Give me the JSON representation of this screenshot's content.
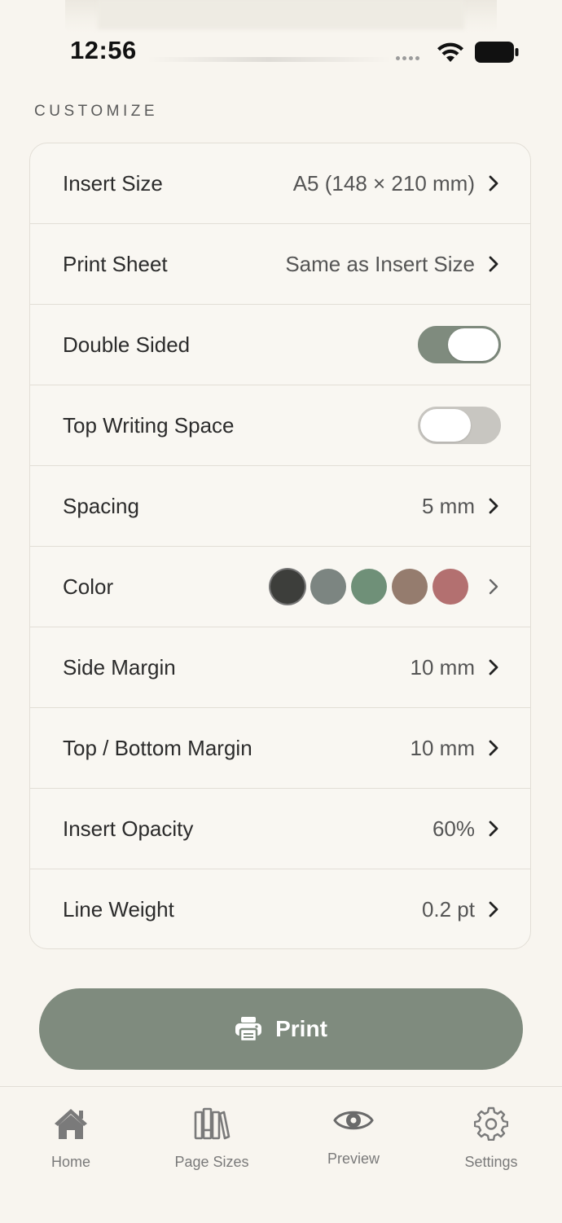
{
  "status_bar": {
    "time": "12:56"
  },
  "section": {
    "title": "CUSTOMIZE"
  },
  "settings": [
    {
      "label": "Insert Size",
      "value": "A5 (148 × 210 mm)",
      "kind": "link"
    },
    {
      "label": "Print Sheet",
      "value": "Same as Insert Size",
      "kind": "link"
    },
    {
      "label": "Double Sided",
      "kind": "toggle",
      "on": true
    },
    {
      "label": "Top Writing Space",
      "kind": "toggle",
      "on": false
    },
    {
      "label": "Spacing",
      "value": "5 mm",
      "kind": "link"
    },
    {
      "label": "Color",
      "kind": "colors",
      "colors": [
        "#3d3e3b",
        "#7c8581",
        "#6f9078",
        "#957c6e",
        "#b37070"
      ],
      "selected_index": 0
    },
    {
      "label": "Side Margin",
      "value": "10 mm",
      "kind": "link"
    },
    {
      "label": "Top / Bottom Margin",
      "value": "10 mm",
      "kind": "link"
    },
    {
      "label": "Insert Opacity",
      "value": "60%",
      "kind": "link"
    },
    {
      "label": "Line Weight",
      "value": "0.2 pt",
      "kind": "link"
    }
  ],
  "print_button": {
    "label": "Print",
    "icon": "printer-icon"
  },
  "tab_bar": {
    "items": [
      {
        "label": "Home",
        "icon": "home-icon"
      },
      {
        "label": "Page Sizes",
        "icon": "books-icon"
      },
      {
        "label": "Preview",
        "icon": "eye-icon"
      },
      {
        "label": "Settings",
        "icon": "gear-icon"
      }
    ]
  },
  "colors": {
    "accent": "#7f8b7e",
    "background": "#f8f5ef",
    "toggle_off": "#c8c6c1"
  }
}
